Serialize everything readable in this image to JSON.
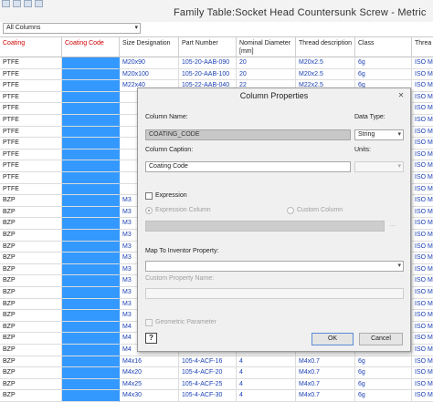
{
  "window": {
    "title": "Family Table:Socket Head Countersunk Screw - Metric"
  },
  "filter": {
    "value": "All Columns"
  },
  "columns": [
    {
      "label": "Coating"
    },
    {
      "label": "Coating Code"
    },
    {
      "label": "Size Designation"
    },
    {
      "label": "Part Number"
    },
    {
      "label": "Nominal Diameter [mm]"
    },
    {
      "label": "Thread description"
    },
    {
      "label": "Class"
    },
    {
      "label": "Threa"
    }
  ],
  "rows": [
    {
      "coating": "PTFE",
      "size": "M20x90",
      "part": "105-20-AAB-090",
      "nom": "20",
      "thread": "M20x2.5",
      "cls": "6g",
      "std": "ISO M"
    },
    {
      "coating": "PTFE",
      "size": "M20x100",
      "part": "105-20-AAB-100",
      "nom": "20",
      "thread": "M20x2.5",
      "cls": "6g",
      "std": "ISO M"
    },
    {
      "coating": "PTFE",
      "size": "M22x40",
      "part": "105-22-AAB-040",
      "nom": "22",
      "thread": "M22x2.5",
      "cls": "6g",
      "std": "ISO M"
    },
    {
      "coating": "PTFE",
      "size": "",
      "part": "",
      "nom": "",
      "thread": "",
      "cls": "",
      "std": "ISO M"
    },
    {
      "coating": "PTFE",
      "size": "",
      "part": "",
      "nom": "",
      "thread": "",
      "cls": "",
      "std": "ISO M"
    },
    {
      "coating": "PTFE",
      "size": "",
      "part": "",
      "nom": "",
      "thread": "",
      "cls": "",
      "std": "ISO M"
    },
    {
      "coating": "PTFE",
      "size": "",
      "part": "",
      "nom": "",
      "thread": "",
      "cls": "",
      "std": "ISO M"
    },
    {
      "coating": "PTFE",
      "size": "",
      "part": "",
      "nom": "",
      "thread": "",
      "cls": "",
      "std": "ISO M"
    },
    {
      "coating": "PTFE",
      "size": "",
      "part": "",
      "nom": "",
      "thread": "",
      "cls": "",
      "std": "ISO M"
    },
    {
      "coating": "PTFE",
      "size": "",
      "part": "",
      "nom": "",
      "thread": "",
      "cls": "",
      "std": "ISO M"
    },
    {
      "coating": "PTFE",
      "size": "",
      "part": "",
      "nom": "",
      "thread": "",
      "cls": "",
      "std": "ISO M"
    },
    {
      "coating": "PTFE",
      "size": "",
      "part": "",
      "nom": "",
      "thread": "",
      "cls": "",
      "std": "ISO M"
    },
    {
      "coating": "BZP",
      "size": "M3",
      "part": "",
      "nom": "",
      "thread": "",
      "cls": "",
      "std": "ISO M"
    },
    {
      "coating": "BZP",
      "size": "M3",
      "part": "",
      "nom": "",
      "thread": "",
      "cls": "",
      "std": "ISO M"
    },
    {
      "coating": "BZP",
      "size": "M3",
      "part": "",
      "nom": "",
      "thread": "",
      "cls": "",
      "std": "ISO M"
    },
    {
      "coating": "BZP",
      "size": "M3",
      "part": "",
      "nom": "",
      "thread": "",
      "cls": "",
      "std": "ISO M"
    },
    {
      "coating": "BZP",
      "size": "M3",
      "part": "",
      "nom": "",
      "thread": "",
      "cls": "",
      "std": "ISO M"
    },
    {
      "coating": "BZP",
      "size": "M3",
      "part": "",
      "nom": "",
      "thread": "",
      "cls": "",
      "std": "ISO M"
    },
    {
      "coating": "BZP",
      "size": "M3",
      "part": "",
      "nom": "",
      "thread": "",
      "cls": "",
      "std": "ISO M"
    },
    {
      "coating": "BZP",
      "size": "M3",
      "part": "",
      "nom": "",
      "thread": "",
      "cls": "",
      "std": "ISO M"
    },
    {
      "coating": "BZP",
      "size": "M3",
      "part": "",
      "nom": "",
      "thread": "",
      "cls": "",
      "std": "ISO M"
    },
    {
      "coating": "BZP",
      "size": "M3",
      "part": "",
      "nom": "",
      "thread": "",
      "cls": "",
      "std": "ISO M"
    },
    {
      "coating": "BZP",
      "size": "M3",
      "part": "",
      "nom": "",
      "thread": "",
      "cls": "",
      "std": "ISO M"
    },
    {
      "coating": "BZP",
      "size": "M4",
      "part": "",
      "nom": "",
      "thread": "",
      "cls": "",
      "std": "ISO M"
    },
    {
      "coating": "BZP",
      "size": "M4",
      "part": "",
      "nom": "",
      "thread": "",
      "cls": "",
      "std": "ISO M"
    },
    {
      "coating": "BZP",
      "size": "M4",
      "part": "",
      "nom": "",
      "thread": "",
      "cls": "",
      "std": "ISO M"
    },
    {
      "coating": "BZP",
      "size": "M4x16",
      "part": "105-4-ACF-16",
      "nom": "4",
      "thread": "M4x0.7",
      "cls": "6g",
      "std": "ISO M"
    },
    {
      "coating": "BZP",
      "size": "M4x20",
      "part": "105-4-ACF-20",
      "nom": "4",
      "thread": "M4x0.7",
      "cls": "6g",
      "std": "ISO M"
    },
    {
      "coating": "BZP",
      "size": "M4x25",
      "part": "105-4-ACF-25",
      "nom": "4",
      "thread": "M4x0.7",
      "cls": "6g",
      "std": "ISO M"
    },
    {
      "coating": "BZP",
      "size": "M4x30",
      "part": "105-4-ACF-30",
      "nom": "4",
      "thread": "M4x0.7",
      "cls": "6g",
      "std": "ISO M"
    }
  ],
  "dialog": {
    "title": "Column Properties",
    "column_name_label": "Column Name:",
    "column_name_value": "COATING_CODE",
    "data_type_label": "Data Type:",
    "data_type_value": "String",
    "caption_label": "Column Caption:",
    "caption_value": "Coating Code",
    "units_label": "Units:",
    "units_value": "",
    "expression_label": "Expression",
    "expression_column_label": "Expression Column",
    "custom_column_label": "Custom Column",
    "expression_browse": "...",
    "map_label": "Map To Inventor Property:",
    "map_value": "",
    "custom_property_label": "Custom Property Name:",
    "custom_property_value": "",
    "geometric_label": "Geometric Parameter",
    "help_label": "?",
    "ok_label": "OK",
    "cancel_label": "Cancel",
    "close_icon": "close-icon"
  },
  "colors": {
    "selected_column": "#3399ff",
    "header_key": "#d00000",
    "link_text": "#1a3fb3"
  }
}
